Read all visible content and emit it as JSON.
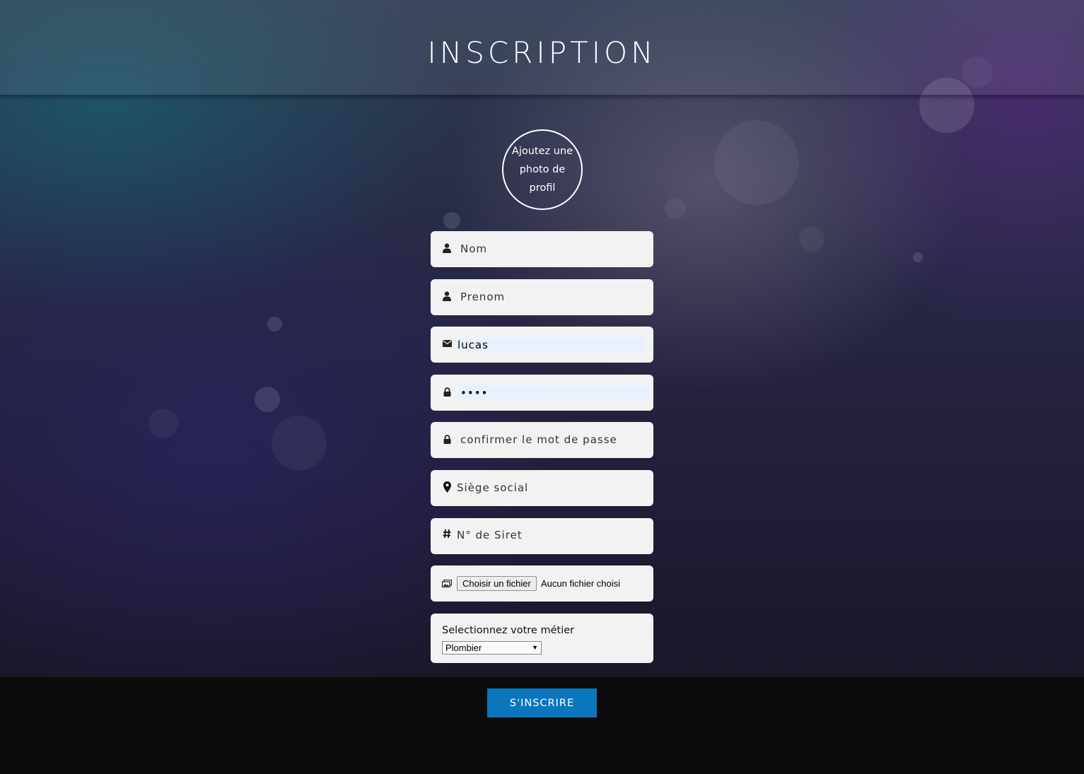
{
  "header": {
    "corner_text": "",
    "title": "INSCRIPTION"
  },
  "photo": {
    "label": "Ajoutez une photo de profil"
  },
  "form": {
    "nom": {
      "placeholder": "Nom",
      "value": "",
      "icon": "user-icon"
    },
    "prenom": {
      "placeholder": "Prenom",
      "value": "",
      "icon": "user-icon"
    },
    "email": {
      "placeholder": "",
      "value": "lucas",
      "icon": "envelope-icon"
    },
    "password": {
      "placeholder": "",
      "value": "1234",
      "icon": "lock-icon"
    },
    "confirm": {
      "placeholder": "confirmer le mot de passe",
      "value": "",
      "icon": "lock-icon"
    },
    "siege": {
      "placeholder": "Siège social",
      "value": "",
      "icon": "map-marker-icon"
    },
    "siret": {
      "placeholder": "N° de Siret",
      "value": "",
      "icon": "hash-icon"
    },
    "file": {
      "button_label": "Choisir un fichier",
      "status": "Aucun fichier choisi",
      "icon": "image-icon"
    },
    "metier": {
      "label": "Selectionnez votre métier",
      "selected": "Plombier"
    }
  },
  "submit": {
    "label": "S'INSCRIRE"
  },
  "colors": {
    "accent": "#0a77bd",
    "field_bg": "#f2f2f2",
    "autofill_bg": "#e8f0fe",
    "footer_bg": "#0b0b0b"
  }
}
